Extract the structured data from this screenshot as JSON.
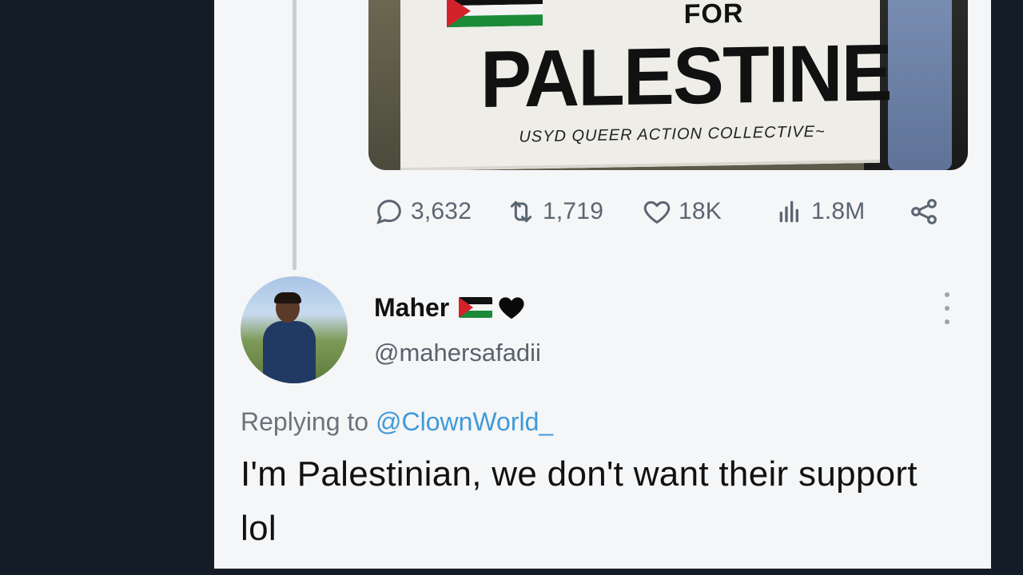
{
  "tweet": {
    "image": {
      "banner_top": "FOR",
      "banner_main": "PALESTINE",
      "banner_sub": "USYD QUEER ACTION COLLECTIVE~"
    },
    "stats": {
      "replies": "3,632",
      "retweets": "1,719",
      "likes": "18K",
      "views": "1.8M"
    }
  },
  "reply": {
    "display_name": "Maher",
    "name_emoji": [
      "palestine-flag",
      "black-heart"
    ],
    "handle": "@mahersafadii",
    "replying_prefix": "Replying to",
    "replying_to": "@ClownWorld_",
    "text": "I'm Palestinian, we don't want their support lol"
  },
  "colors": {
    "page_bg": "#141c27",
    "card_bg": "#f5f6f7",
    "mention": "#3f9ad9",
    "muted": "#59636d"
  }
}
